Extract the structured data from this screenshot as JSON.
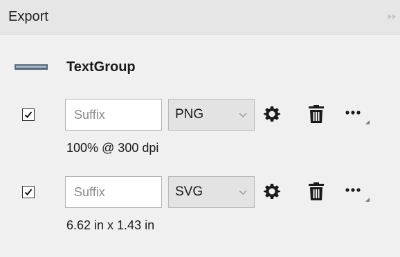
{
  "panel": {
    "title": "Export"
  },
  "object": {
    "name": "TextGroup"
  },
  "export_settings": [
    {
      "checked": true,
      "suffix_value": "",
      "suffix_placeholder": "Suffix",
      "format": "PNG",
      "description": "100% @ 300 dpi"
    },
    {
      "checked": true,
      "suffix_value": "",
      "suffix_placeholder": "Suffix",
      "format": "SVG",
      "description": "6.62 in x 1.43 in"
    }
  ],
  "icons": {
    "collapse": "double-chevron-right-icon",
    "object": "layer-bar-icon",
    "settings": "gear-icon",
    "delete": "trash-icon",
    "more": "more-options-icon"
  },
  "colors": {
    "panel_background": "#f0f0f0",
    "header_background": "#e6e6e6",
    "icon": "#1a1a1a",
    "object_icon": "#5a6b7d"
  }
}
